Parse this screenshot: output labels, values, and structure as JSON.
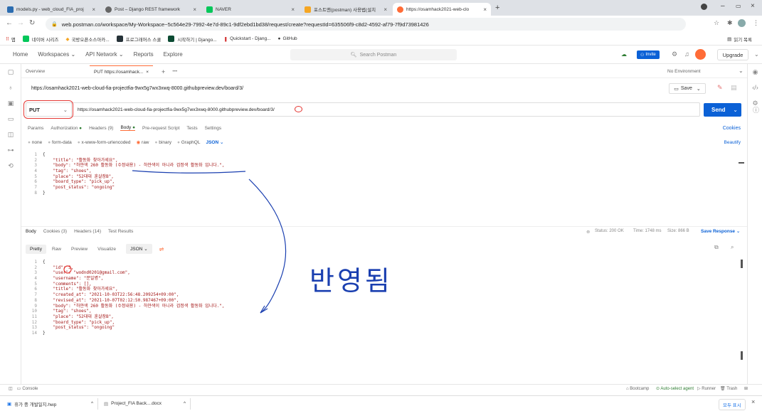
{
  "browser": {
    "tabs": [
      {
        "title": "models.py - web_cloud_FIA_proj",
        "color": "#2b6cb0"
      },
      {
        "title": "Post – Django REST framework",
        "color": "#666666"
      },
      {
        "title": "NAVER",
        "color": "#03c75a"
      },
      {
        "title": "포스트맨(postman) 사용법(설치",
        "color": "#f5a623"
      },
      {
        "title": "https://osamhack2021-web-clo",
        "color": "#ff6c37"
      }
    ],
    "url": "web.postman.co/workspace/My-Workspace~5c564e29-7992-4e7d-89c1-9df2ebd1bd38/request/create?requestId=635506f9-c8d2-4592-af79-7f9d73981426",
    "bookmarks": [
      "앱",
      "네이버 시리즈",
      "국방오픈소스아카...",
      "프로그래머스 스쿨",
      "시작하기 | Django...",
      "Quickstart - Djang...",
      "GitHub"
    ],
    "bookmarks_right": "읽기 목록"
  },
  "postman": {
    "nav": [
      "Home",
      "Workspaces",
      "API Network",
      "Reports",
      "Explore"
    ],
    "search_placeholder": "Search Postman",
    "invite_label": "Invite",
    "upgrade_label": "Upgrade",
    "overview_tab": "Overview",
    "request_tab": "PUT https://osamhack...",
    "more_tabs": "•••",
    "environment": "No Environment",
    "request_title": "https://osamhack2021-web-cloud-fia-projectfia-9wx5g7wx3xwq-8000.githubpreview.dev/board/3/",
    "save_label": "Save",
    "method": "PUT",
    "request_url": "https://osamhack2021-web-cloud-fia-projectfia-9wx5g7wx3xwq-8000.githubpreview.dev/board/3/",
    "send_label": "Send",
    "req_tabs": [
      "Params",
      "Authorization",
      "Headers (9)",
      "Body",
      "Pre-request Script",
      "Tests",
      "Settings"
    ],
    "cookies_label": "Cookies",
    "body_types": [
      "none",
      "form-data",
      "x-www-form-urlencoded",
      "raw",
      "binary",
      "GraphQL"
    ],
    "json_label": "JSON",
    "beautify_label": "Beautify",
    "request_body": [
      "{",
      "    \"title\": \"활동화 찾아가세요\",",
      "    \"body\": \"하얀색 260 활동화 (수정내용) - 하얀색이 아니라 검정색 활동화 입니다.\",",
      "    \"tag\": \"shoes\",",
      "    \"place\": \"52대대 훈살장B\",",
      "    \"board_type\": \"pick_up\",",
      "    \"post_status\": \"ongoing\"",
      "}"
    ],
    "resp_tabs": [
      "Body",
      "Cookies (3)",
      "Headers (14)",
      "Test Results"
    ],
    "status_text": "Status: 200 OK",
    "time_text": "Time: 1748 ms",
    "size_text": "Size: 866 B",
    "save_response": "Save Response",
    "view_tabs": [
      "Pretty",
      "Raw",
      "Preview",
      "Visualize"
    ],
    "response_body": [
      "{",
      "    \"id\": 3,",
      "    \"user\": \"wodnd0201@gmail.com\",",
      "    \"username\": \"문일병\",",
      "    \"comments\": [],",
      "    \"title\": \"활동화 찾아가세요\",",
      "    \"created_at\": \"2021-10-03T22:56:48.209254+09:00\",",
      "    \"revised_at\": \"2021-10-07T02:12:50.987467+09:00\",",
      "    \"body\": \"하얀색 260 활동화 (수정내용) - 하얀색이 아니라 검정색 활동화 입니다.\",",
      "    \"tag\": \"shoes\",",
      "    \"place\": \"52대대 훈살장B\",",
      "    \"board_type\": \"pick_up\",",
      "    \"post_status\": \"ongoing\"",
      "}"
    ],
    "annotation": "반영됨",
    "console_label": "Console",
    "status_items": [
      "Bootcamp",
      "Auto-select agent",
      "Runner",
      "Trash"
    ]
  },
  "downloads": {
    "items": [
      "휴가 중 개발일지.hwp",
      "Project_FIA Back....docx"
    ],
    "show_all": "모두 표시"
  }
}
